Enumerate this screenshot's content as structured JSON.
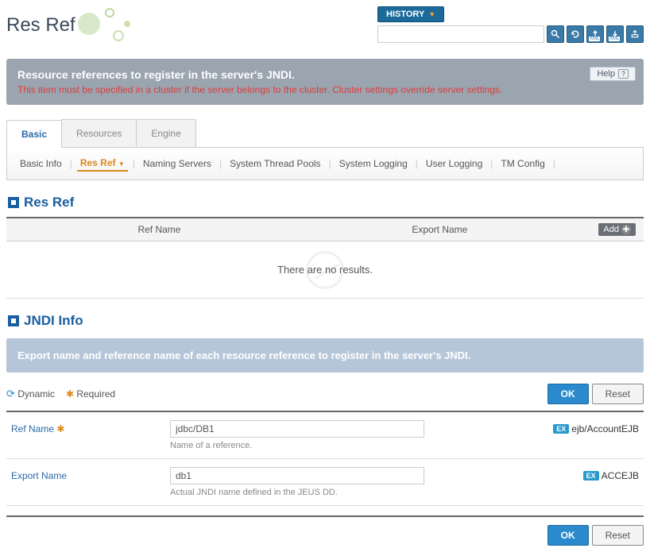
{
  "header": {
    "page_title": "Res Ref",
    "history_label": "HISTORY"
  },
  "toolbar": {
    "search_placeholder": ""
  },
  "banner": {
    "title": "Resource references to register in the server's JNDI.",
    "note": "This item must be specified in a cluster if the server belongs to the cluster. Cluster settings override server settings.",
    "help_label": "Help"
  },
  "main_tabs": [
    "Basic",
    "Resources",
    "Engine"
  ],
  "sub_nav": [
    "Basic Info",
    "Res Ref",
    "Naming Servers",
    "System Thread Pools",
    "System Logging",
    "User Logging",
    "TM Config"
  ],
  "section_resref": {
    "title": "Res Ref",
    "col_ref": "Ref Name",
    "col_export": "Export Name",
    "add_label": "Add",
    "no_results": "There are no results."
  },
  "section_jndi": {
    "title": "JNDI Info",
    "banner": "Export name and reference name of each resource reference to register in the server's JNDI."
  },
  "legend": {
    "dynamic": "Dynamic",
    "required": "Required"
  },
  "buttons": {
    "ok": "OK",
    "reset": "Reset"
  },
  "form": {
    "ref_name": {
      "label": "Ref Name",
      "value": "jdbc/DB1",
      "hint": "Name of a reference.",
      "example": "ejb/AccountEJB"
    },
    "export_name": {
      "label": "Export Name",
      "value": "db1",
      "hint": "Actual JNDI name defined in the JEUS DD.",
      "example": "ACCEJB"
    }
  }
}
